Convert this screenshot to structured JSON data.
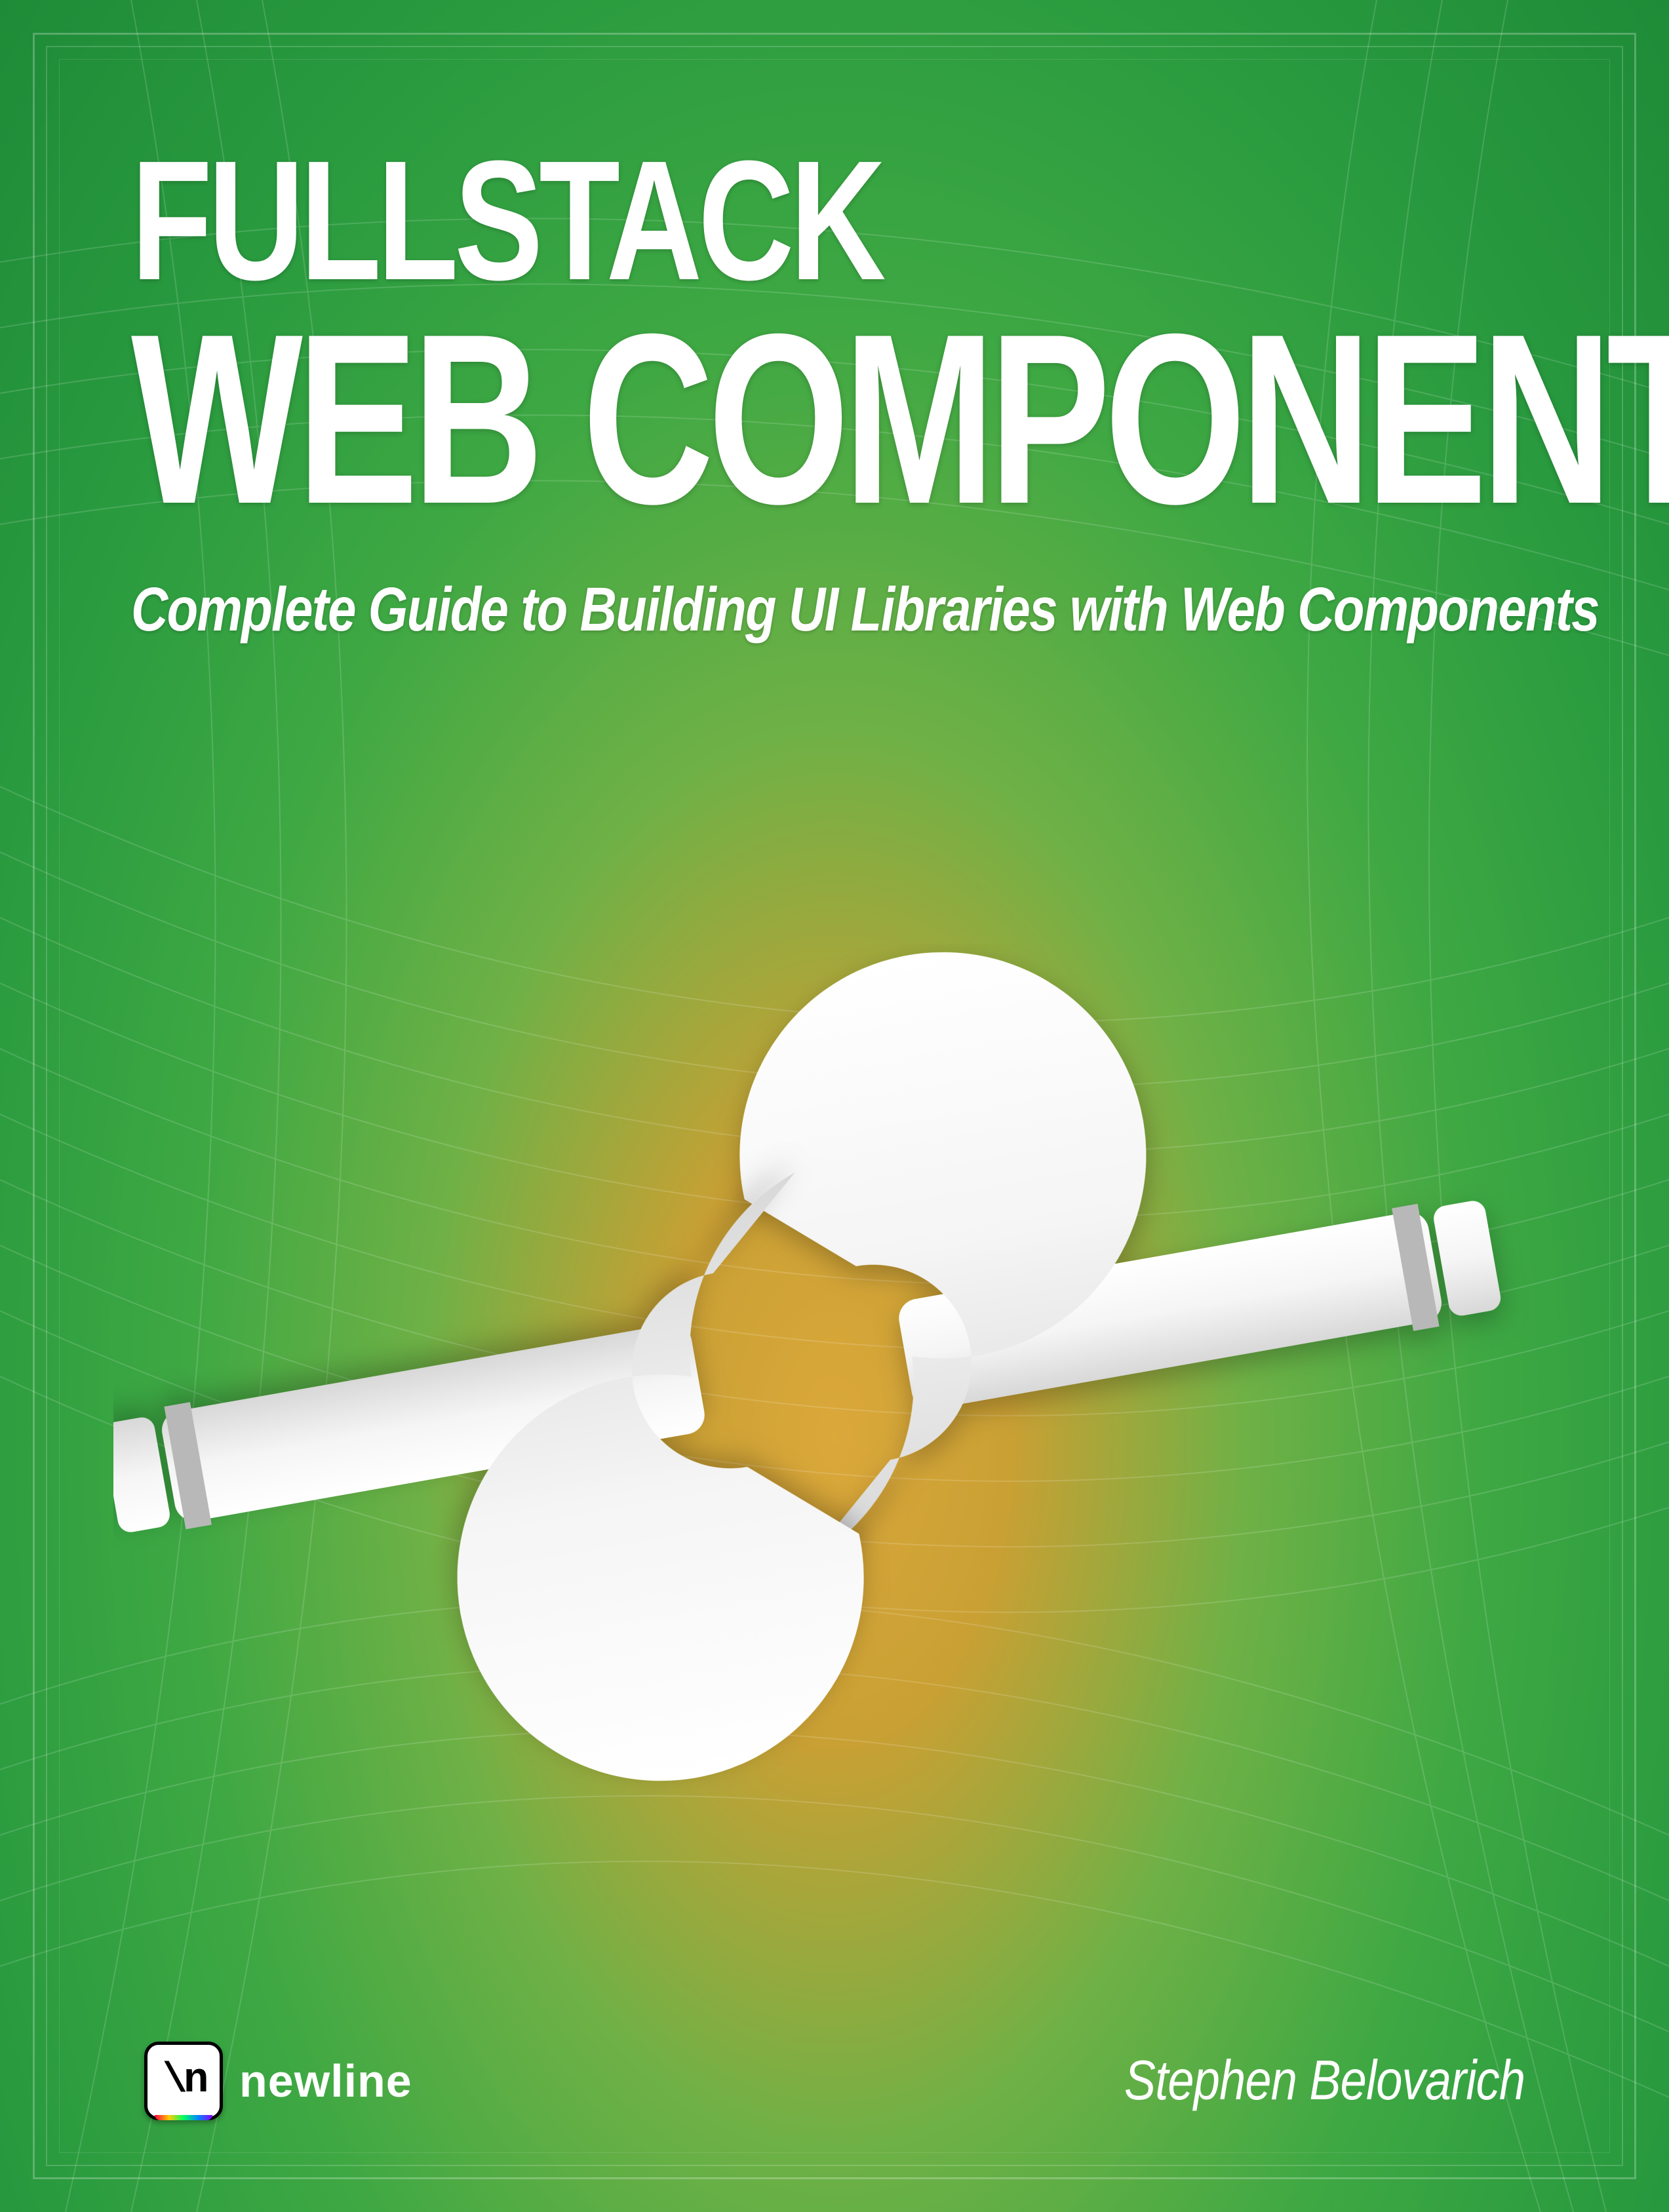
{
  "cover": {
    "title_line1": "FULLSTACK",
    "title_line2": "WEB COMPONENTS",
    "subtitle": "Complete Guide to Building UI Libraries with Web Components",
    "author": "Stephen Belovarich",
    "publisher": {
      "name": "newline",
      "logo_symbol": "\\n"
    },
    "illustration_name": "interlocking-wrenches-icon",
    "colors": {
      "green_outer": "#1e8b38",
      "green_mid": "#3ea843",
      "yellow_center": "#dba83a",
      "text": "#ffffff"
    }
  }
}
